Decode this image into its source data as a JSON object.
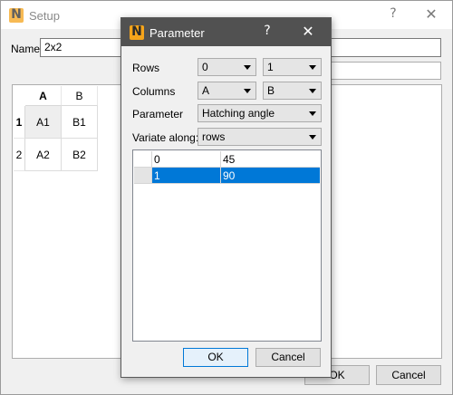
{
  "app": {
    "logo_letter": "N",
    "logo_color": "#f5a41b"
  },
  "setup": {
    "title": "Setup",
    "help_glyph": "?",
    "close_glyph": "✕",
    "name_label": "Name",
    "name_value": "2x2",
    "grid": {
      "col_headers": [
        "A",
        "B"
      ],
      "row_headers": [
        "1",
        "2"
      ],
      "cells": [
        [
          "A1",
          "B1"
        ],
        [
          "A2",
          "B2"
        ]
      ],
      "current_cell": "A1"
    },
    "ok_label": "OK",
    "cancel_label": "Cancel"
  },
  "parameter": {
    "title": "Parameter",
    "help_glyph": "?",
    "close_glyph": "✕",
    "rows_label": "Rows",
    "rows_from": "0",
    "rows_to": "1",
    "columns_label": "Columns",
    "columns_from": "A",
    "columns_to": "B",
    "parameter_label": "Parameter",
    "parameter_value": "Hatching angle",
    "variate_label": "Variate along:",
    "variate_value": "rows",
    "table": [
      {
        "key": "0",
        "value": "45",
        "selected": false
      },
      {
        "key": "1",
        "value": "90",
        "selected": true
      }
    ],
    "ok_label": "OK",
    "cancel_label": "Cancel",
    "selection_color": "#0078d7"
  }
}
